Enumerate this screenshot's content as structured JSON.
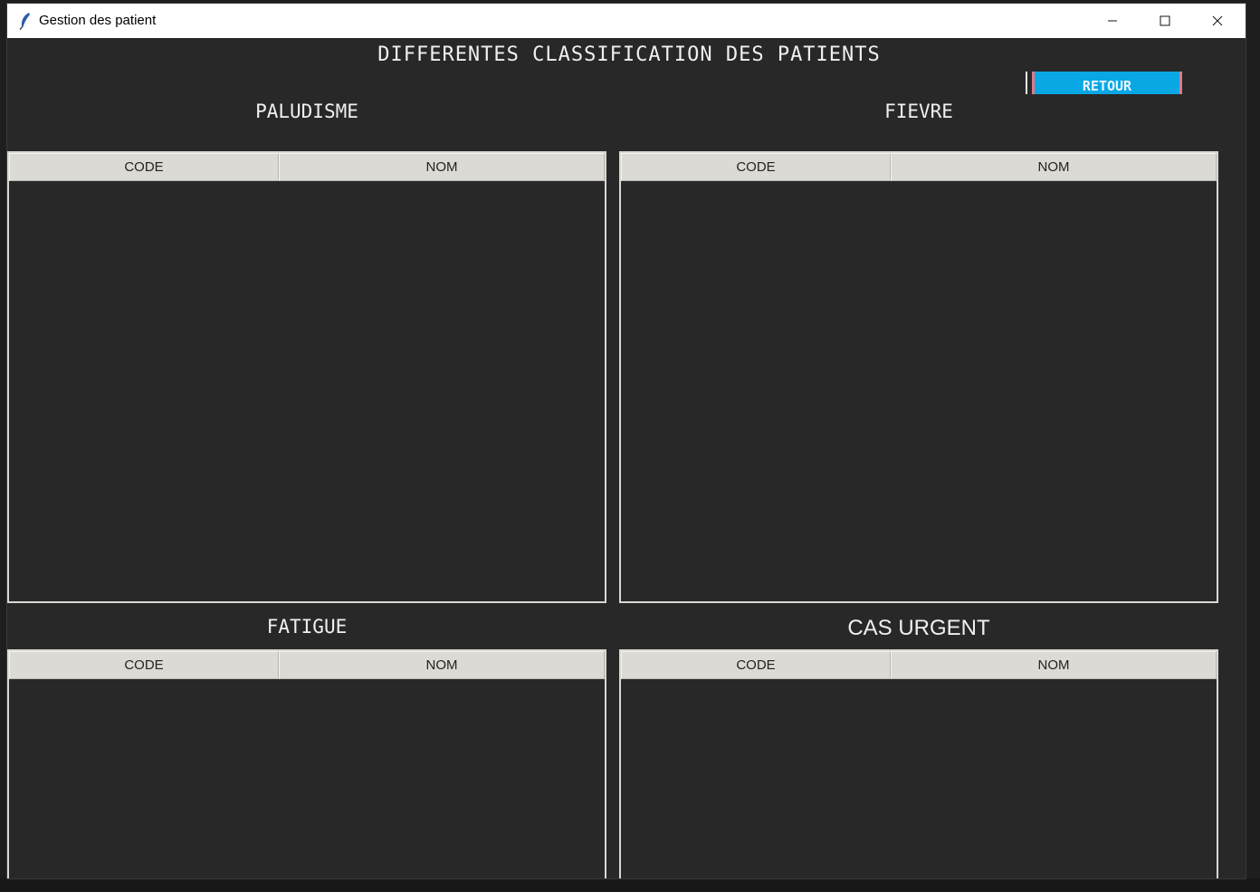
{
  "window": {
    "title": "Gestion des patient"
  },
  "page": {
    "title": "DIFFERENTES CLASSIFICATION DES PATIENTS",
    "back_button": "RETOUR"
  },
  "sections": [
    {
      "title": "PALUDISME",
      "columns": [
        "CODE",
        "NOM"
      ],
      "rows": []
    },
    {
      "title": "FIEVRE",
      "columns": [
        "CODE",
        "NOM"
      ],
      "rows": []
    },
    {
      "title": "FATIGUE",
      "columns": [
        "CODE",
        "NOM"
      ],
      "rows": []
    },
    {
      "title": "CAS URGENT",
      "columns": [
        "CODE",
        "NOM"
      ],
      "rows": []
    }
  ],
  "colors": {
    "window_bg": "#282828",
    "accent_button": "#0aa7e5",
    "header_cell": "#dcdad5"
  }
}
